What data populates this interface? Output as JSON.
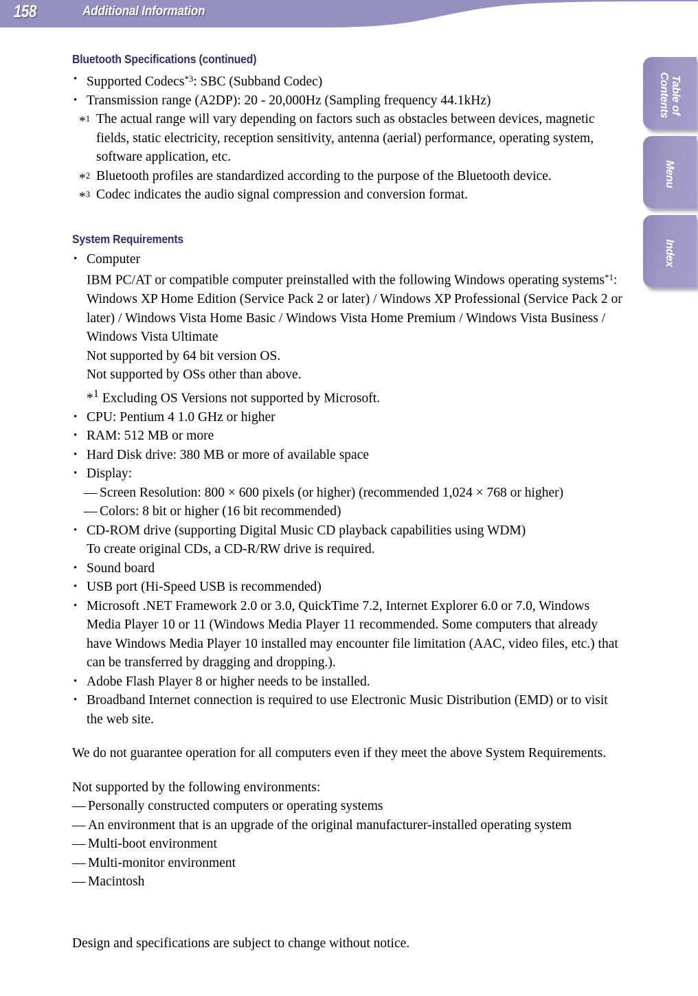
{
  "header": {
    "page_number": "158",
    "title": "Additional Information",
    "banner_color": "#9591be"
  },
  "side_tabs": [
    {
      "label": "Table of\nContents",
      "name": "table-of-contents"
    },
    {
      "label": "Menu",
      "name": "menu"
    },
    {
      "label": "Index",
      "name": "index"
    }
  ],
  "sections": {
    "bluetooth": {
      "heading": "Bluetooth Specifications (continued)",
      "heading_color": "#332d6e",
      "bullets": [
        "Supported Codecs*³: SBC (Subband Codec)",
        "Transmission range (A2DP): 20 - 20,000Hz (Sampling frequency 44.1kHz)"
      ],
      "footnotes": [
        {
          "mark": "*1",
          "text": "The actual range will vary depending on factors such as obstacles between devices, magnetic fields, static electricity, reception sensitivity, antenna (aerial) performance, operating system, software application, etc."
        },
        {
          "mark": "*2",
          "text": "Bluetooth profiles are standardized according to the purpose of the Bluetooth device."
        },
        {
          "mark": "*3",
          "text": "Codec indicates the audio signal compression and conversion format."
        }
      ]
    },
    "system_requirements": {
      "heading": "System Requirements",
      "computer_bullet": "Computer",
      "computer_lines": [
        "IBM PC/AT or compatible computer preinstalled with the following Windows operating systems*¹:",
        "Windows XP Home Edition (Service Pack 2 or later) / Windows XP Professional (Service Pack 2 or later) / Windows Vista Home Basic / Windows Vista Home Premium / Windows Vista Business / Windows Vista Ultimate",
        "Not supported by 64 bit version OS.",
        "Not supported by OSs other than above."
      ],
      "computer_footnote": {
        "mark": "*1",
        "text": "Excluding OS Versions not supported by Microsoft."
      },
      "bullets": [
        "CPU: Pentium 4 1.0 GHz or higher",
        "RAM: 512 MB or more",
        "Hard Disk drive: 380 MB or more of available space"
      ],
      "display_bullet": "Display:",
      "display_sub": [
        "Screen Resolution: 800 × 600 pixels (or higher) (recommended 1,024 × 768 or higher)",
        "Colors: 8 bit or higher (16 bit recommended)"
      ],
      "cdrom_bullet": "CD-ROM drive (supporting Digital Music CD playback capabilities using WDM)",
      "cdrom_sub": "To create original CDs, a CD-R/RW drive is required.",
      "bullets2": [
        "Sound board",
        "USB port (Hi-Speed USB is recommended)"
      ],
      "framework_bullet": "Microsoft .NET Framework 2.0 or 3.0, QuickTime 7.2, Internet Explorer 6.0 or 7.0, Windows Media Player 10 or 11 (Windows Media Player 11 recommended. Some computers that already have Windows Media Player 10 installed may encounter file limitation (AAC, video files, etc.) that can be transferred by dragging and dropping.).",
      "bullets3": [
        "Adobe Flash Player 8 or higher needs to be installed.",
        "Broadband Internet connection is required to use Electronic Music Distribution (EMD) or to visit the web site."
      ],
      "guarantee_note": "We do not guarantee operation for all computers even if they meet the above System Requirements.",
      "unsupported_intro": "Not supported by the following environments:",
      "unsupported_items": [
        "Personally constructed computers or operating systems",
        "An environment that is an upgrade of the original manufacturer-installed operating system",
        "Multi-boot environment",
        "Multi-monitor environment",
        "Macintosh"
      ]
    }
  },
  "footer": {
    "note": "Design and specifications are subject to change without notice."
  }
}
